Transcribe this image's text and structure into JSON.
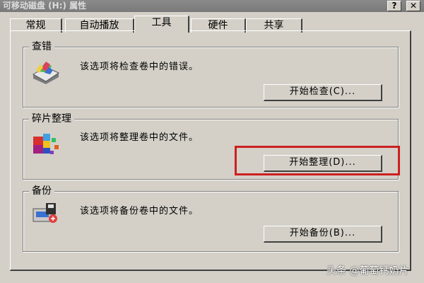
{
  "window": {
    "title": "可移动磁盘 (H:) 属性",
    "help_label": "?",
    "close_label": "✕"
  },
  "tabs": [
    {
      "label": "常规",
      "active": false
    },
    {
      "label": "自动播放",
      "active": false
    },
    {
      "label": "工具",
      "active": true
    },
    {
      "label": "硬件",
      "active": false
    },
    {
      "label": "共享",
      "active": false
    }
  ],
  "groups": {
    "check": {
      "title": "查错",
      "description": "该选项将检查卷中的错误。",
      "button_label": "开始检查(C)...",
      "icon": "disk-check-icon"
    },
    "defrag": {
      "title": "碎片整理",
      "description": "该选项将整理卷中的文件。",
      "button_label": "开始整理(D)...",
      "icon": "defrag-icon"
    },
    "backup": {
      "title": "备份",
      "description": "该选项将备份卷中的文件。",
      "button_label": "开始备份(B)...",
      "icon": "backup-icon"
    }
  },
  "watermark": "头条 @葡萄钙奶片",
  "colors": {
    "face": "#d4d0c8",
    "highlight_box": "#cc2020"
  }
}
